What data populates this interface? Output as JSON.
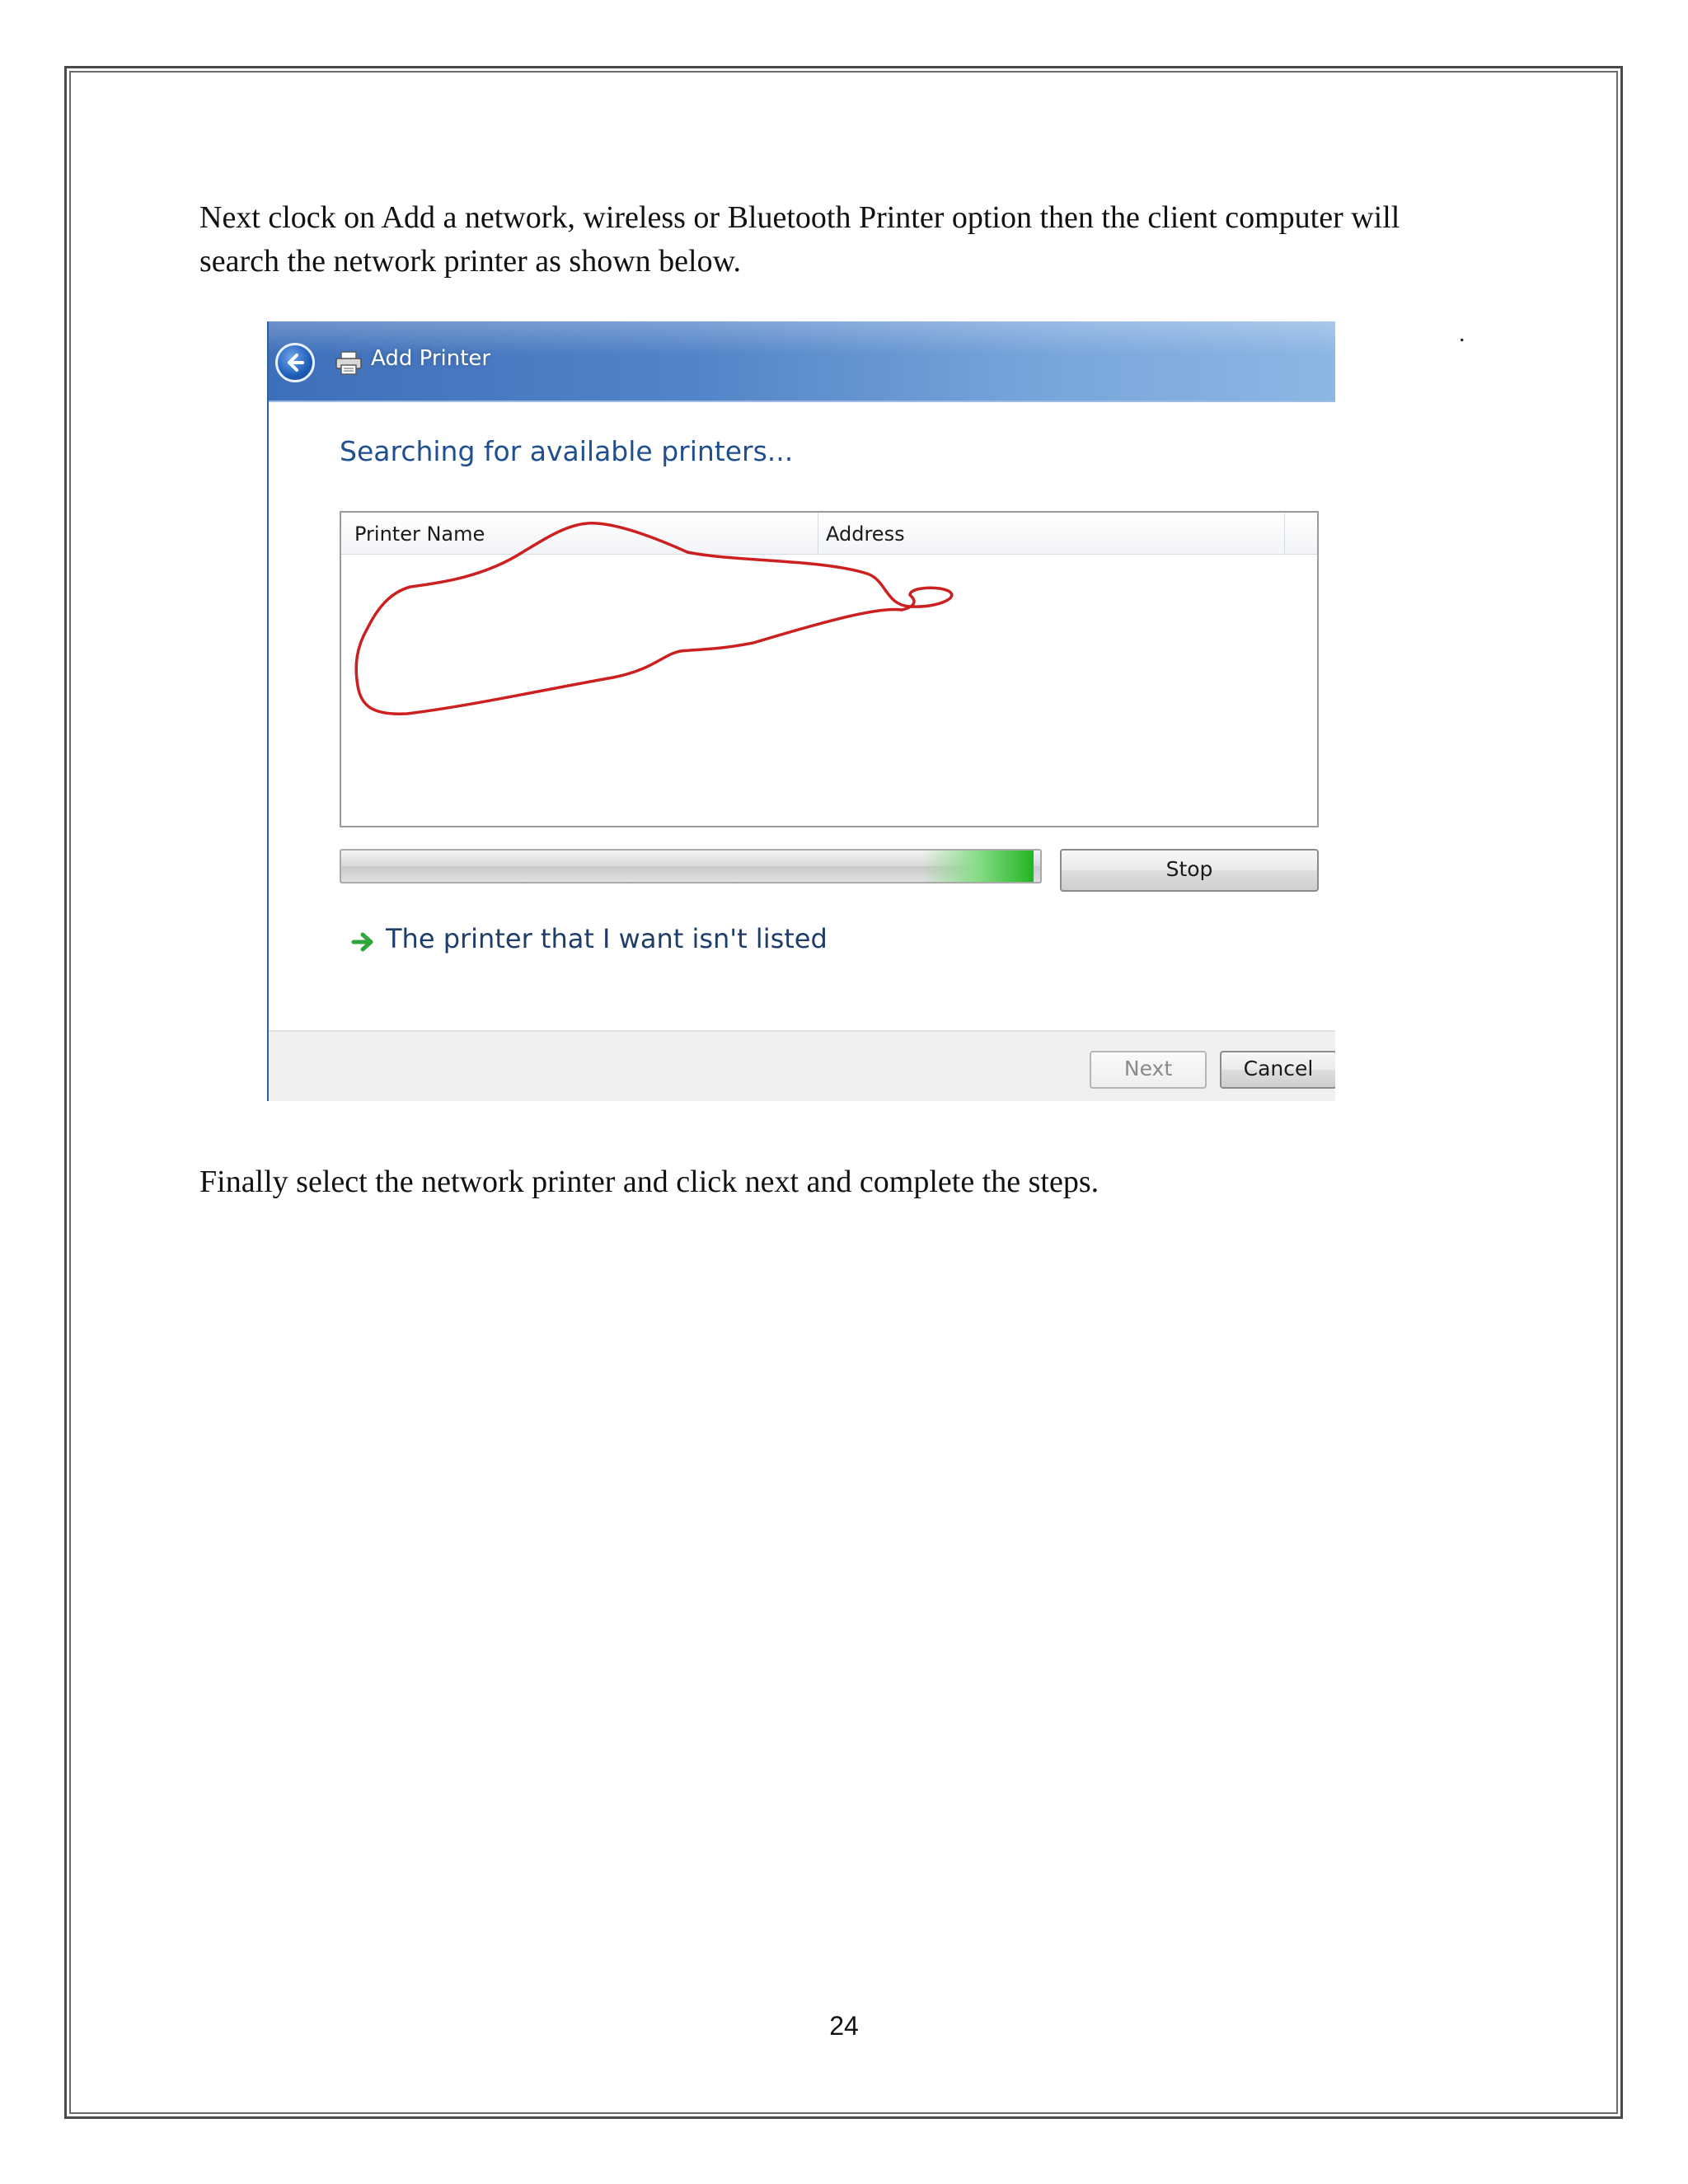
{
  "document": {
    "paragraph_1": "Next clock on Add a network, wireless or Bluetooth Printer option then the client computer will search the network printer as shown below.",
    "paragraph_2": "Finally select the network printer and click next and complete the steps.",
    "stray_mark": ".",
    "page_number": "24"
  },
  "dialog": {
    "title": "Add Printer",
    "heading": "Searching for available printers...",
    "columns": [
      "Printer Name",
      "Address"
    ],
    "progress_fraction": 0.99,
    "stop_label": "Stop",
    "link_label": "The printer that I want isn't listed",
    "next_label": "Next",
    "cancel_label": "Cancel",
    "annotation_color": "#cc2020",
    "accent_color": "#1f4f8f"
  }
}
